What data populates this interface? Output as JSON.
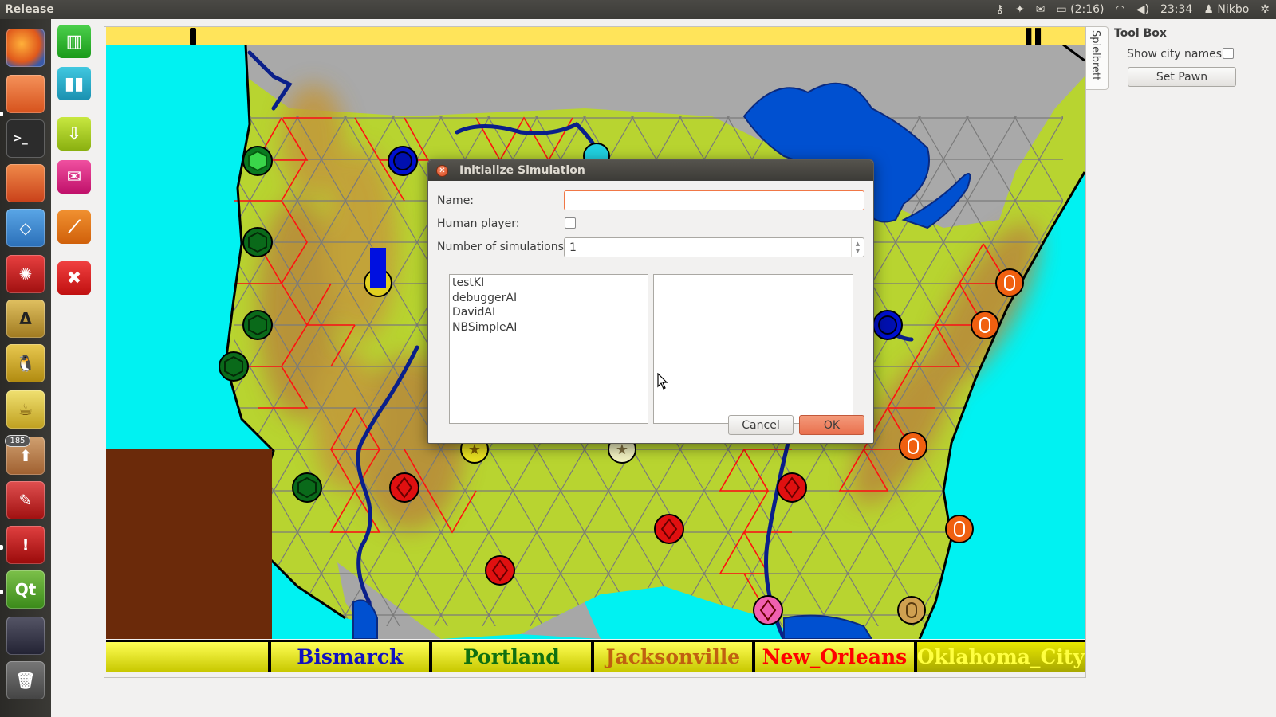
{
  "top_panel": {
    "app_title": "Release",
    "battery": "(2:16)",
    "time": "23:34",
    "user": "Nikbo"
  },
  "launcher": {
    "items": [
      "firefox-icon",
      "files-icon",
      "terminal-icon",
      "software-center-icon",
      "dropbox-icon",
      "network-icon",
      "inkscape-icon",
      "tux-icon",
      "teapot-icon",
      "update-manager-icon",
      "text-editor-icon",
      "error-report-icon",
      "qt-creator-icon",
      "screenshot-icon",
      "trash-icon"
    ],
    "badge": "185"
  },
  "toolbar": {
    "buttons": [
      "grid-icon",
      "bar-chart-icon",
      "download-icon",
      "mail-icon",
      "draw-icon",
      "close-icon"
    ]
  },
  "side_tab": {
    "label": "Spielbrett"
  },
  "toolbox": {
    "title": "Tool Box",
    "show_city_names_label": "Show city names:",
    "show_city_names_checked": false,
    "set_pawn_label": "Set Pawn"
  },
  "city_bar": {
    "cities": [
      {
        "name": "",
        "color": "#c8c800"
      },
      {
        "name": "Bismarck",
        "color": "#1010c0"
      },
      {
        "name": "Portland",
        "color": "#107010"
      },
      {
        "name": "Jacksonville",
        "color": "#c06010"
      },
      {
        "name": "New_Orleans",
        "color": "#ff0000"
      },
      {
        "name": "Oklahoma_City",
        "color": "#ffff40"
      }
    ]
  },
  "dialog": {
    "title": "Initialize Simulation",
    "name_label": "Name:",
    "name_value": "",
    "human_player_label": "Human player:",
    "human_player_checked": false,
    "num_sims_label": "Number of simulations:",
    "num_sims_value": "1",
    "available_ais": [
      "testKI",
      "debuggerAI",
      "DavidAI",
      "NBSimpleAI"
    ],
    "selected_ais": [],
    "cancel_label": "Cancel",
    "ok_label": "OK"
  },
  "colors": {
    "ocean": "#00f0f0",
    "land": "#b8d430",
    "mountain": "#c49a3a",
    "timeline": "#ffe45a",
    "ok_accent": "#e9704e"
  }
}
